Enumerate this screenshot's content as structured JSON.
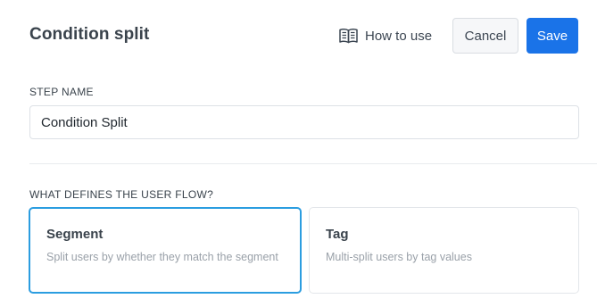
{
  "header": {
    "title": "Condition split",
    "how_to_use_label": "How to use",
    "how_to_use_icon": "book-open-icon",
    "cancel_label": "Cancel",
    "save_label": "Save"
  },
  "step_name": {
    "label": "STEP NAME",
    "value": "Condition Split"
  },
  "flow": {
    "label": "WHAT DEFINES THE USER FLOW?",
    "selected": "Segment",
    "options": [
      {
        "title": "Segment",
        "description": "Split users by whether they match the segment"
      },
      {
        "title": "Tag",
        "description": "Multi-split users by tag values"
      }
    ]
  },
  "colors": {
    "primary": "#1a73e8",
    "selected_border": "#2b9de0",
    "text": "#3a434c",
    "muted": "#9aa1a9"
  }
}
